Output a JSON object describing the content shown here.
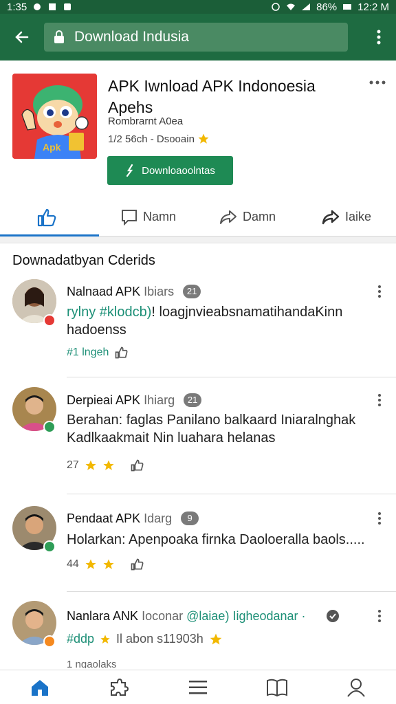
{
  "status_bar": {
    "time": "1:35",
    "battery": "86%",
    "clock_right": "12:2 M"
  },
  "toolbar": {
    "url_text": "Download Indusia"
  },
  "app": {
    "title": "APK Iwnload APK Indonoesia Apehs",
    "developer": "Rombrarnt A0ea",
    "meta": "1/2 56ch - Dsooain",
    "install_label": "Downloaoolntas",
    "icon_text": "Apk"
  },
  "tabs": [
    {
      "label": "",
      "icon": "thumbs-up-icon"
    },
    {
      "label": "Namn",
      "icon": "comment-icon"
    },
    {
      "label": "Damn",
      "icon": "share-icon"
    },
    {
      "label": "Iaike",
      "icon": "forward-icon"
    }
  ],
  "section_title": "Downadatbyan Cderids",
  "reviews": [
    {
      "name": "Nalnaad APK",
      "role": "Ibiars",
      "count": "21",
      "body_highlight": "rylny #klodcb)",
      "body": "! loagjnvieabsnamatihandaKinn hadoenss",
      "footer_green": "#1 lngeh",
      "badge_color": "#e53935"
    },
    {
      "name": "Derpieai APK",
      "role": "Ihiarg",
      "count": "21",
      "body_highlight": "",
      "body": "Berahan: faglas Panilano balkaard Iniaralnghak Kadlkaakmait Nin luahara helanas",
      "footer_green": "",
      "footer_count": "27",
      "badge_color": "#2e9d57"
    },
    {
      "name": "Pendaat APK",
      "role": "Idarg",
      "count": "9",
      "body_highlight": "",
      "body": "Holarkan: Apenpoaka firnka Daoloeralla baols.....",
      "footer_green": "",
      "footer_count": "44",
      "badge_color": "#2e9d57"
    },
    {
      "name": "Nanlara ANK",
      "role": "Ioconar",
      "count": "",
      "body_highlight": "@laiae) Iigheodanar ·",
      "body": "",
      "footer_green": "#ddp",
      "footer_text": "Il abon s11903h",
      "badge_color": "#f5891f"
    }
  ],
  "partial_text": "1 ngaolaks",
  "bottom_nav": [
    {
      "icon": "home-icon"
    },
    {
      "icon": "puzzle-icon"
    },
    {
      "icon": "menu-icon"
    },
    {
      "icon": "book-icon"
    },
    {
      "icon": "profile-icon"
    }
  ],
  "colors": {
    "toolbar": "#1e6b41",
    "accent": "#1a73c8",
    "install": "#1e8a54",
    "star": "#f2b800"
  }
}
